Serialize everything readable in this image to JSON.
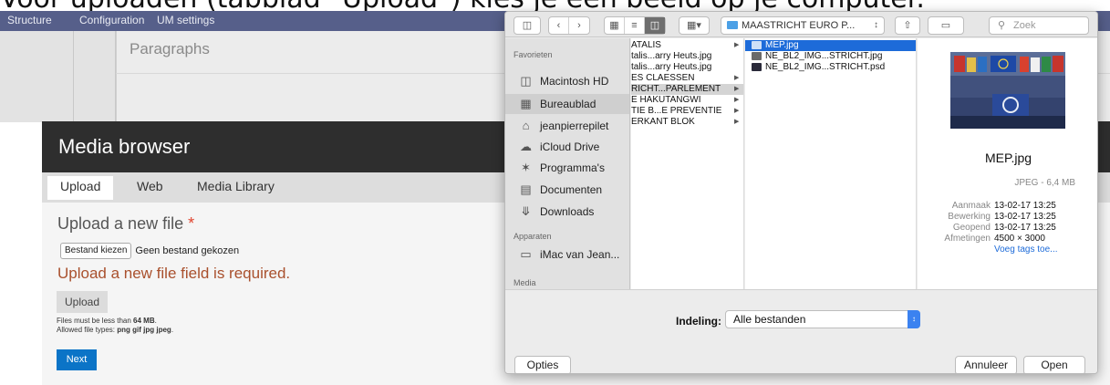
{
  "caption": "Voor uploaden (tabblad \"Upload\") kies je een beeld op je computer.",
  "admin_nav": [
    "Structure",
    "Configuration",
    "UM settings"
  ],
  "paragraphs_label": "Paragraphs",
  "media_browser": {
    "title": "Media browser",
    "tabs": [
      {
        "label": "Upload",
        "active": true
      },
      {
        "label": "Web",
        "active": false
      },
      {
        "label": "Media Library",
        "active": false
      }
    ],
    "upload_label": "Upload a new file",
    "required_mark": "*",
    "choose_file_button": "Bestand kiezen",
    "no_file_text": "Geen bestand gekozen",
    "error_message": "Upload a new file field is required.",
    "upload_button": "Upload",
    "help_size_prefix": "Files must be less than ",
    "help_size_value": "64 MB",
    "help_size_suffix": ".",
    "help_types_prefix": "Allowed file types: ",
    "help_types_value": "png gif jpg jpeg",
    "help_types_suffix": ".",
    "next_button": "Next",
    "next_color": "#0b74c7",
    "error_color": "#a9502d"
  },
  "dialog": {
    "path": "MAASTRICHT EURO P...",
    "search_placeholder": "Zoek",
    "sidebar": {
      "favorites_header": "Favorieten",
      "favorites": [
        {
          "label": "Macintosh HD",
          "icon": "hard-drive-icon",
          "selected": false
        },
        {
          "label": "Bureaublad",
          "icon": "desktop-icon",
          "selected": true
        },
        {
          "label": "jeanpierrepilet",
          "icon": "home-icon",
          "selected": false
        },
        {
          "label": "iCloud Drive",
          "icon": "cloud-icon",
          "selected": false
        },
        {
          "label": "Programma's",
          "icon": "applications-icon",
          "selected": false
        },
        {
          "label": "Documenten",
          "icon": "documents-icon",
          "selected": false
        },
        {
          "label": "Downloads",
          "icon": "downloads-icon",
          "selected": false
        }
      ],
      "devices_header": "Apparaten",
      "devices": [
        {
          "label": "iMac van Jean...",
          "icon": "computer-icon"
        }
      ],
      "media_header": "Media"
    },
    "column1": [
      {
        "label": "ATALIS",
        "folder": true,
        "selected": false
      },
      {
        "label": "talis...arry Heuts.jpg",
        "folder": false,
        "selected": false
      },
      {
        "label": "talis...arry Heuts.jpg",
        "folder": false,
        "selected": false
      },
      {
        "label": "ES CLAESSEN",
        "folder": true,
        "selected": false
      },
      {
        "label": "RICHT...PARLEMENT",
        "folder": true,
        "selected": true
      },
      {
        "label": "E HAKUTANGWI",
        "folder": true,
        "selected": false
      },
      {
        "label": "TIE B...E PREVENTIE",
        "folder": true,
        "selected": false
      },
      {
        "label": "ERKANT BLOK",
        "folder": true,
        "selected": false
      }
    ],
    "column2": [
      {
        "label": "MEP.jpg",
        "selected": true
      },
      {
        "label": "NE_BL2_IMG...STRICHT.jpg",
        "selected": false
      },
      {
        "label": "NE_BL2_IMG...STRICHT.psd",
        "selected": false
      }
    ],
    "preview": {
      "name": "MEP.jpg",
      "type_size": "JPEG - 6,4 MB",
      "meta": [
        {
          "label": "Aanmaak",
          "value": "13-02-17 13:25"
        },
        {
          "label": "Bewerking",
          "value": "13-02-17 13:25"
        },
        {
          "label": "Geopend",
          "value": "13-02-17 13:25"
        },
        {
          "label": "Afmetingen",
          "value": "4500 × 3000"
        }
      ],
      "tags_link": "Voeg tags toe..."
    },
    "format_label": "Indeling:",
    "format_value": "Alle bestanden",
    "options_button": "Opties",
    "cancel_button": "Annuleer",
    "open_button": "Open",
    "selection_color": "#1d6bd9"
  }
}
